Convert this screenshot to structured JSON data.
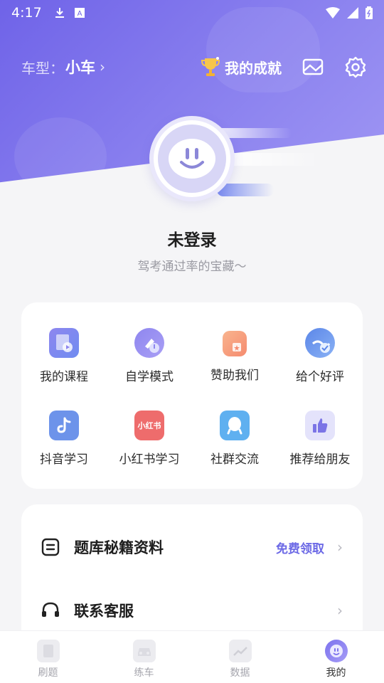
{
  "status_bar": {
    "time": "4:17",
    "icons": [
      "download-icon",
      "a-badge-icon",
      "wifi-icon",
      "signal-icon",
      "battery-icon"
    ]
  },
  "header": {
    "car_type_label": "车型：",
    "car_type_value": "小车",
    "achievements_label": "我的成就",
    "icons": [
      "trophy-icon",
      "mail-icon",
      "gear-icon"
    ]
  },
  "profile": {
    "username": "未登录",
    "tagline": "驾考通过率的宝藏～"
  },
  "grid": {
    "items": [
      {
        "label": "我的课程",
        "icon": "course-icon"
      },
      {
        "label": "自学模式",
        "icon": "self-study-icon"
      },
      {
        "label": "赞助我们",
        "icon": "sponsor-icon"
      },
      {
        "label": "给个好评",
        "icon": "rating-icon"
      },
      {
        "label": "抖音学习",
        "icon": "douyin-icon"
      },
      {
        "label": "小红书学习",
        "icon": "xiaohongshu-icon",
        "badge": "小红书"
      },
      {
        "label": "社群交流",
        "icon": "community-icon"
      },
      {
        "label": "推荐给朋友",
        "icon": "thumbs-up-icon"
      }
    ]
  },
  "list": {
    "items": [
      {
        "label": "题库秘籍资料",
        "extra": "免费领取",
        "icon": "document-icon"
      },
      {
        "label": "联系客服",
        "extra": "",
        "icon": "headset-icon"
      }
    ]
  },
  "tabbar": {
    "items": [
      {
        "label": "刷题",
        "icon": "book-icon",
        "active": false
      },
      {
        "label": "练车",
        "icon": "car-icon",
        "active": false
      },
      {
        "label": "数据",
        "icon": "chart-icon",
        "active": false
      },
      {
        "label": "我的",
        "icon": "profile-icon",
        "active": true
      }
    ]
  },
  "colors": {
    "accent": "#6f63e8",
    "accent_light": "#a89ff6",
    "link": "#6d6ae6",
    "background": "#f5f5f7"
  }
}
